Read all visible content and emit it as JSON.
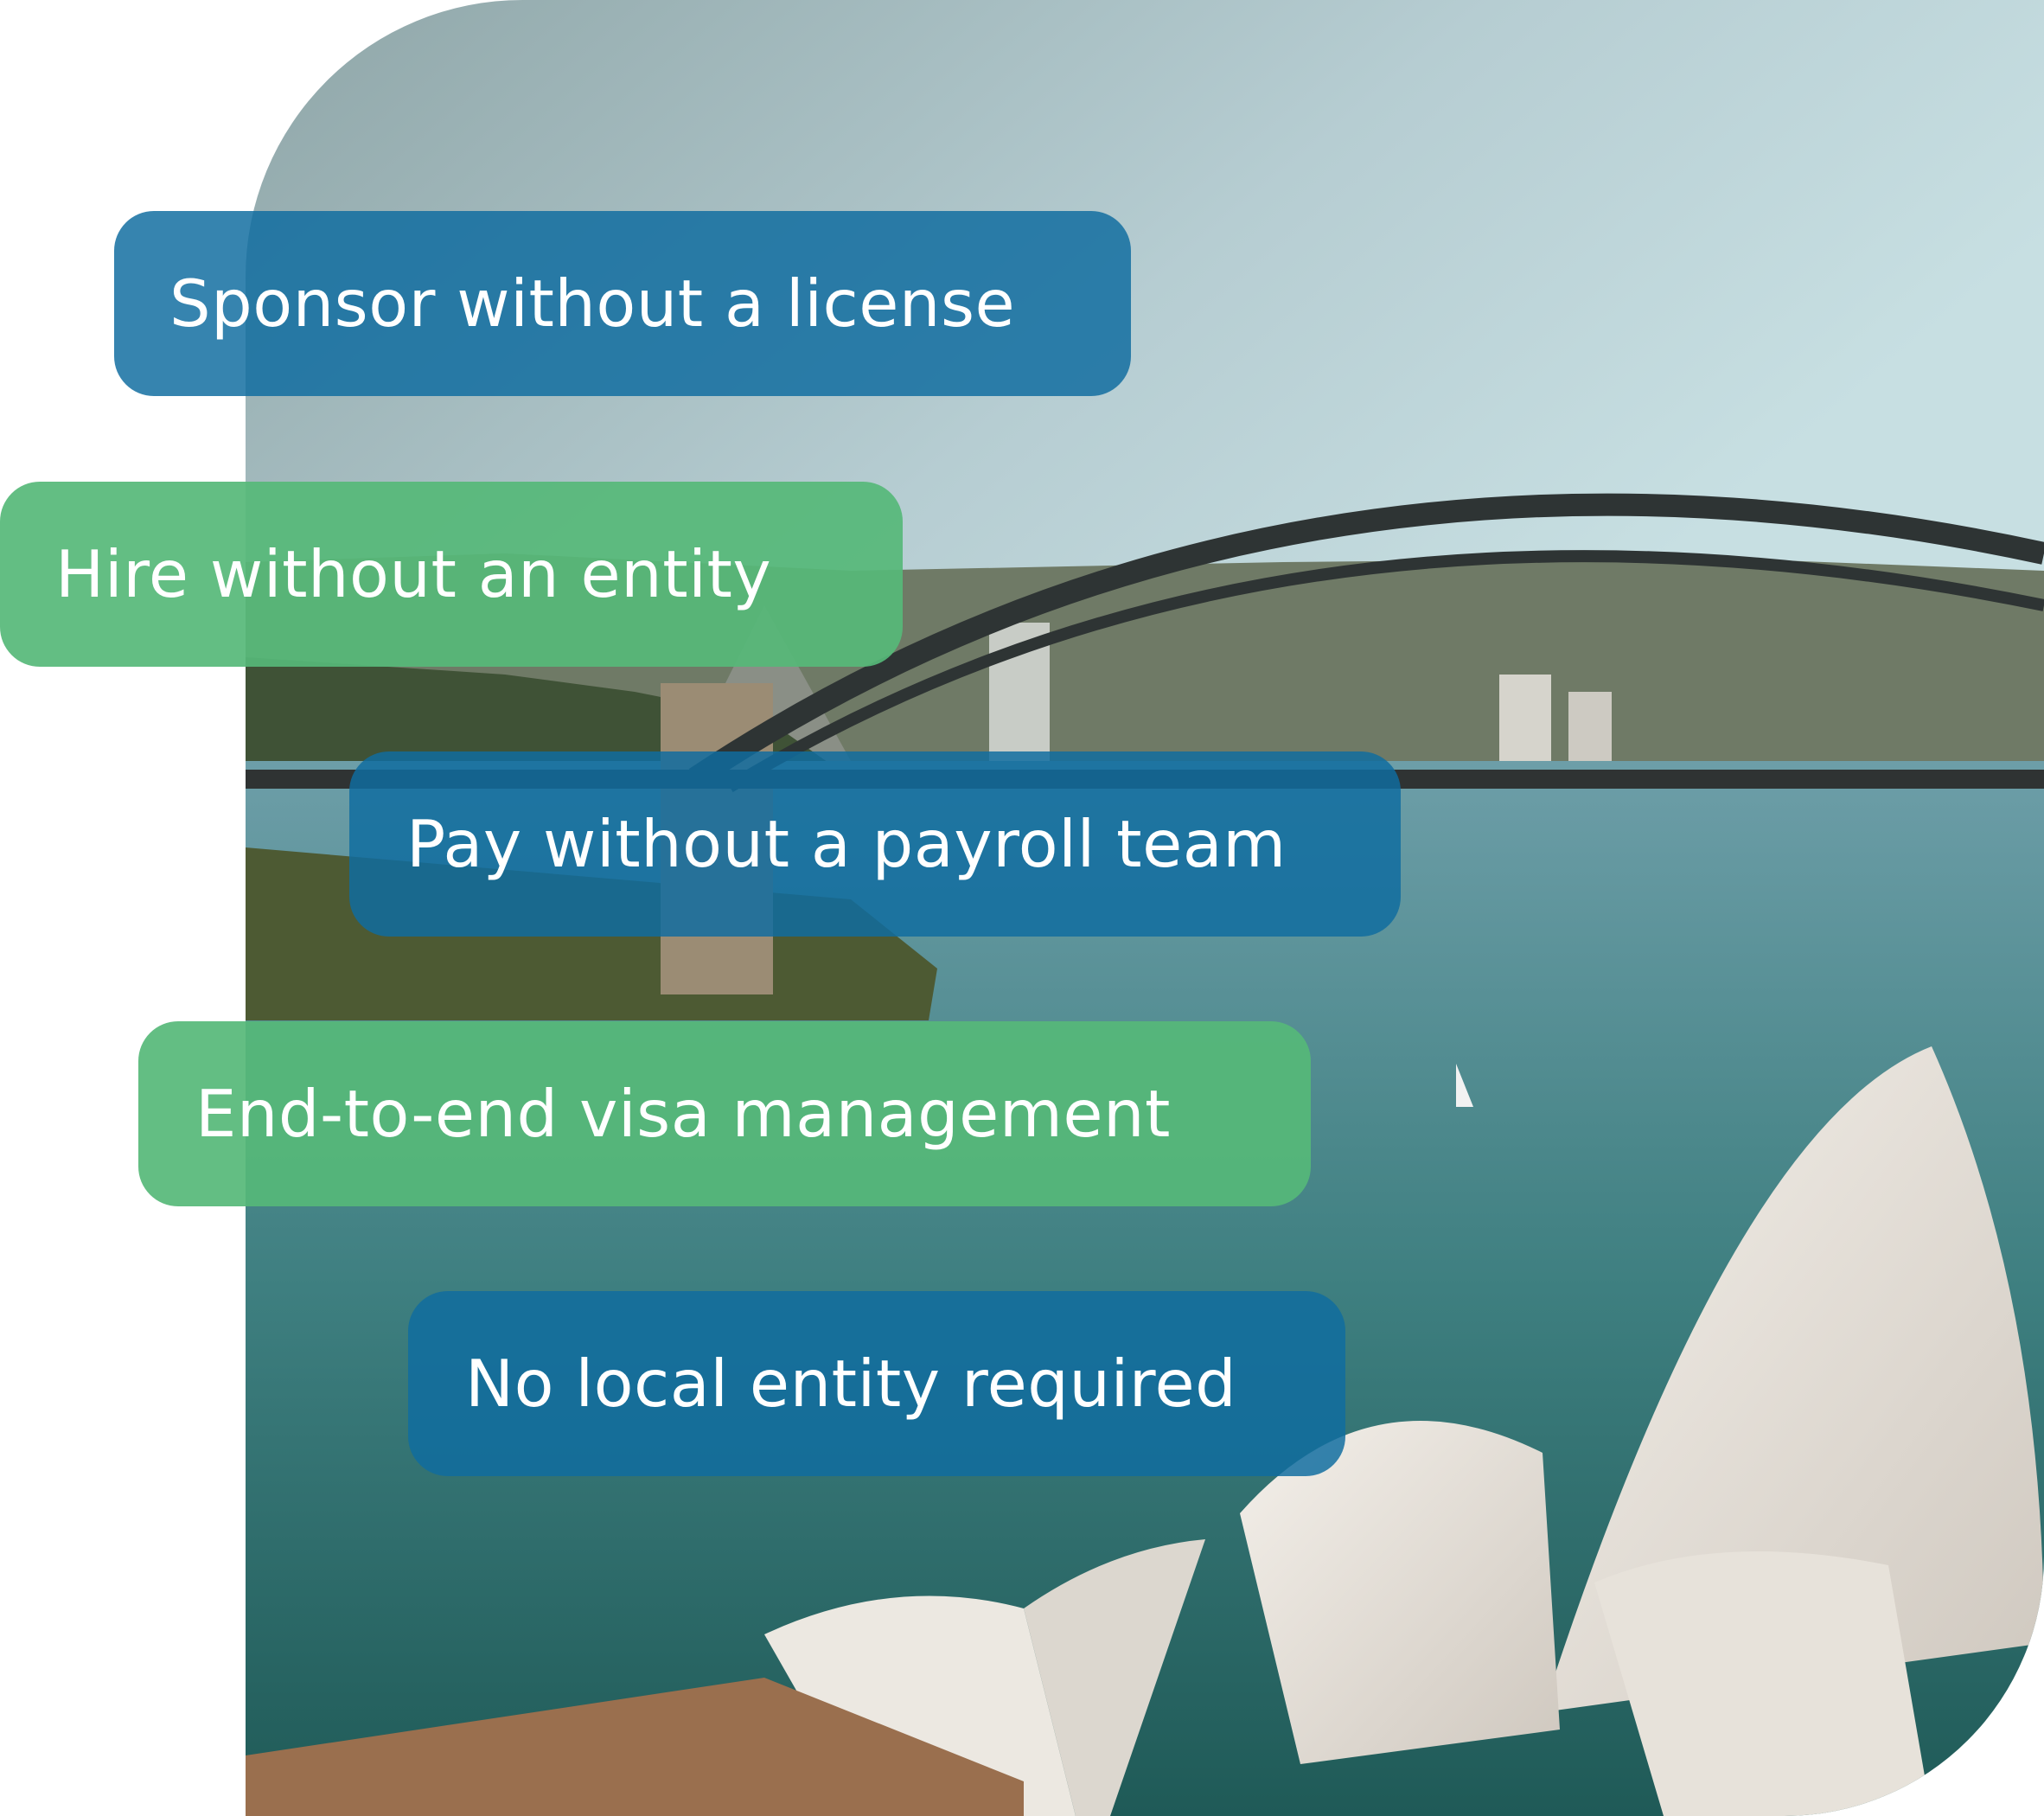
{
  "feature_pills": [
    {
      "label": "Sponsor without a license",
      "style": "blue"
    },
    {
      "label": "Hire without an entity",
      "style": "green"
    },
    {
      "label": "Pay without a payroll team",
      "style": "blue"
    },
    {
      "label": "End-to-end visa management",
      "style": "green"
    },
    {
      "label": "No local entity required",
      "style": "blue"
    }
  ],
  "colors": {
    "blue_pill": "#106ca0",
    "green_pill": "#56b878",
    "text": "#ffffff"
  }
}
